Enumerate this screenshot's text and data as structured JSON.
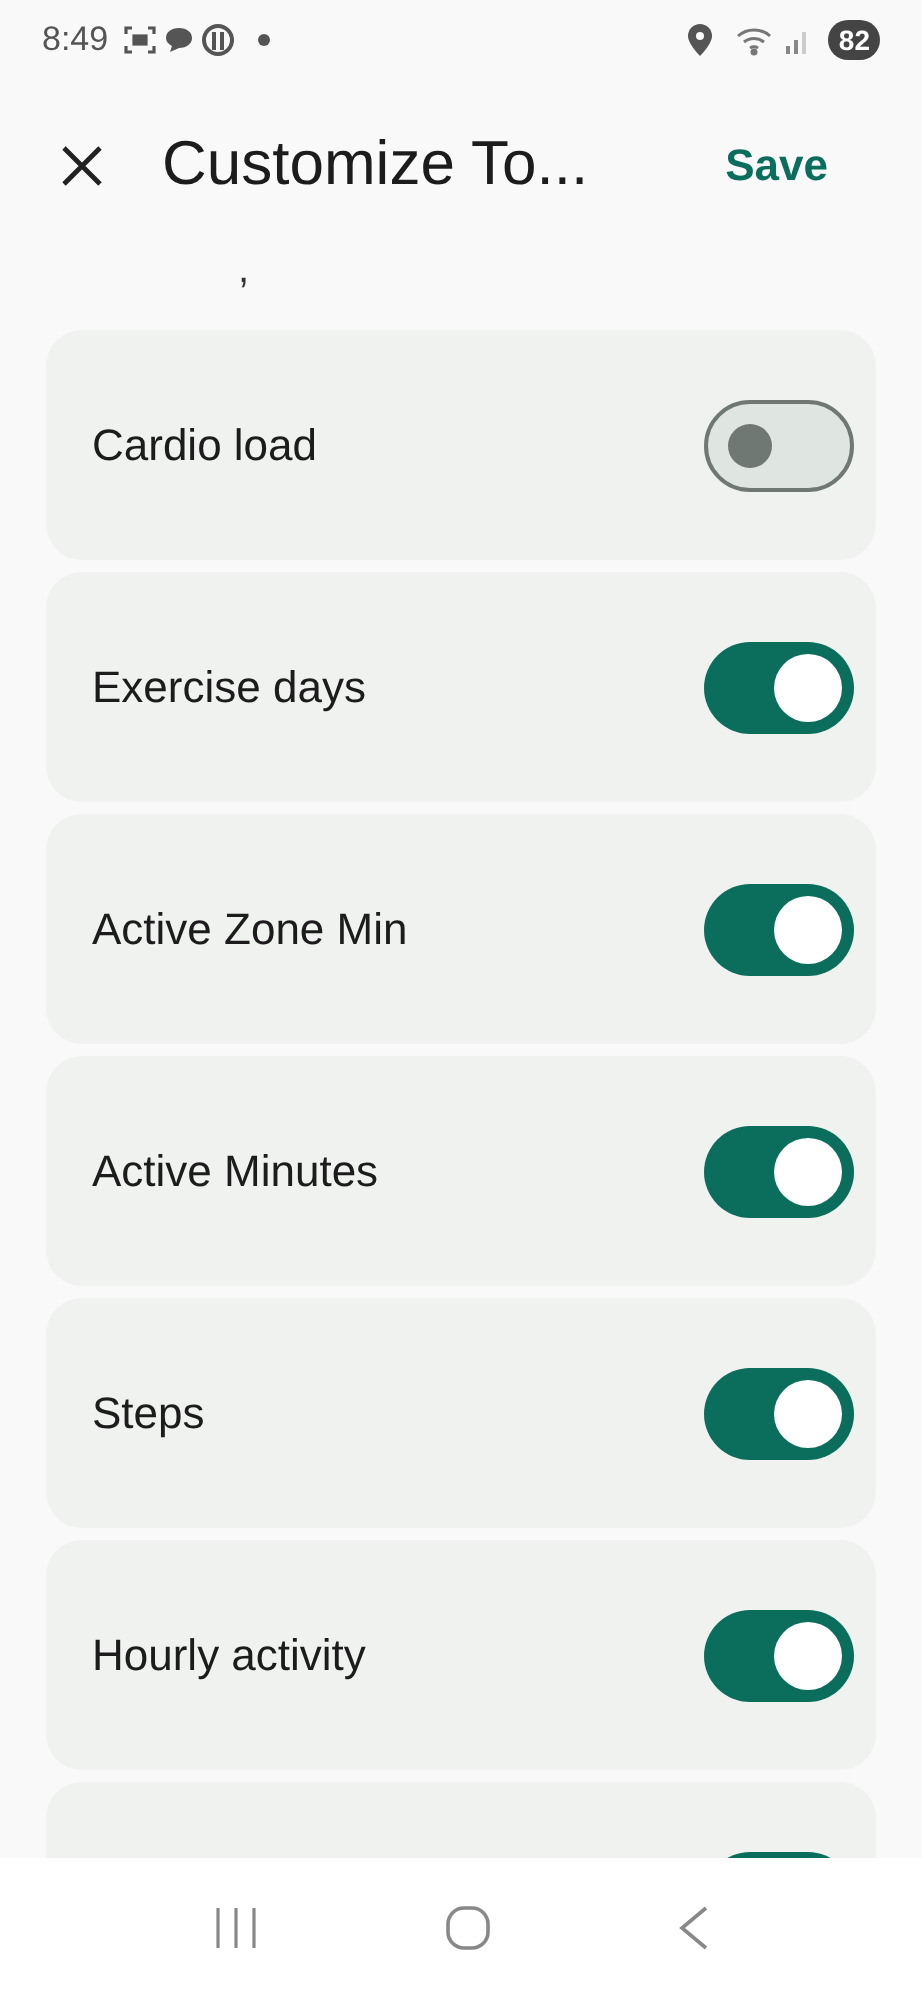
{
  "status_bar": {
    "time": "8:49",
    "battery": "82"
  },
  "header": {
    "title": "Customize To...",
    "action": "Save"
  },
  "scrolled_fragment": ",",
  "items": [
    {
      "label": "Cardio load",
      "on": false
    },
    {
      "label": "Exercise days",
      "on": true
    },
    {
      "label": "Active Zone Min",
      "on": true
    },
    {
      "label": "Active Minutes",
      "on": true
    },
    {
      "label": "Steps",
      "on": true
    },
    {
      "label": "Hourly activity",
      "on": true
    },
    {
      "on": true
    }
  ]
}
